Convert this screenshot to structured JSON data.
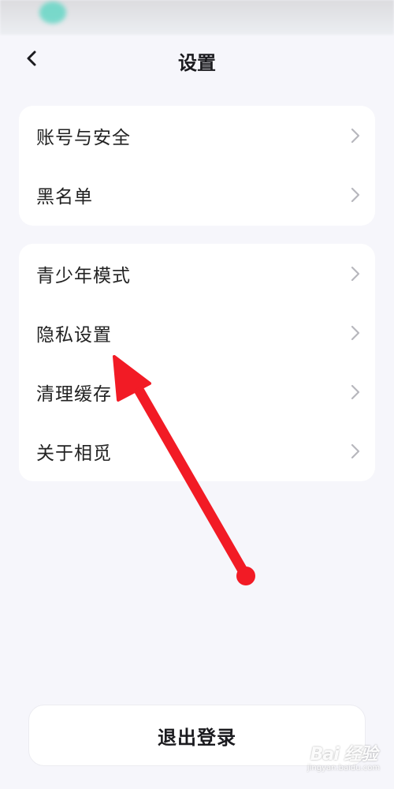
{
  "header": {
    "title": "设置",
    "back_icon": "chevron-left-icon"
  },
  "groups": [
    {
      "items": [
        {
          "label": "账号与安全"
        },
        {
          "label": "黑名单"
        }
      ]
    },
    {
      "items": [
        {
          "label": "青少年模式"
        },
        {
          "label": "隐私设置"
        },
        {
          "label": "清理缓存"
        },
        {
          "label": "关于相觅"
        }
      ]
    }
  ],
  "logout": {
    "label": "退出登录"
  },
  "annotation": {
    "color": "#f21b25",
    "target": "隐私设置"
  },
  "watermark": {
    "main": "Bai 经验",
    "sub": "jingyan.baidu.com"
  },
  "colors": {
    "background": "#f6f6fb",
    "card": "#ffffff",
    "chevron": "#b7b7bd"
  }
}
